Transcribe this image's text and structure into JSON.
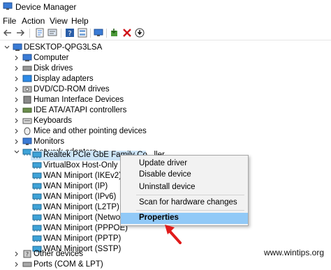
{
  "window": {
    "title": "Device Manager"
  },
  "menu": [
    "File",
    "Action",
    "View",
    "Help"
  ],
  "toolbar": {
    "icons": [
      "back-icon",
      "forward-icon",
      "properties-icon",
      "scan-icon",
      "help-icon",
      "monitor-icon",
      "update-driver-icon",
      "uninstall-icon",
      "disable-icon"
    ]
  },
  "tree": {
    "root": "DESKTOP-QPG3LSA",
    "categories": [
      "Computer",
      "Disk drives",
      "Display adapters",
      "DVD/CD-ROM drives",
      "Human Interface Devices",
      "IDE ATA/ATAPI controllers",
      "Keyboards",
      "Mice and other pointing devices",
      "Monitors",
      "Network adapters"
    ],
    "network_adapters": [
      "Realtek PCIe GbE Family Co...ller",
      "VirtualBox Host-Only Ether",
      "WAN Miniport (IKEv2)",
      "WAN Miniport (IP)",
      "WAN Miniport (IPv6)",
      "WAN Miniport (L2TP)",
      "WAN Miniport (Network M",
      "WAN Miniport (PPPOE)",
      "WAN Miniport (PPTP)",
      "WAN Miniport (SSTP)"
    ],
    "after": [
      "Other devices",
      "Ports (COM & LPT)"
    ]
  },
  "context_menu": {
    "items": [
      "Update driver",
      "Disable device",
      "Uninstall device",
      "Scan for hardware changes",
      "Properties"
    ],
    "highlighted": "Properties"
  },
  "watermark": "www.wintips.org",
  "colors": {
    "highlight": "#91c9f7",
    "arrow": "#e01b1b",
    "selected_row": "#cce4f7"
  }
}
